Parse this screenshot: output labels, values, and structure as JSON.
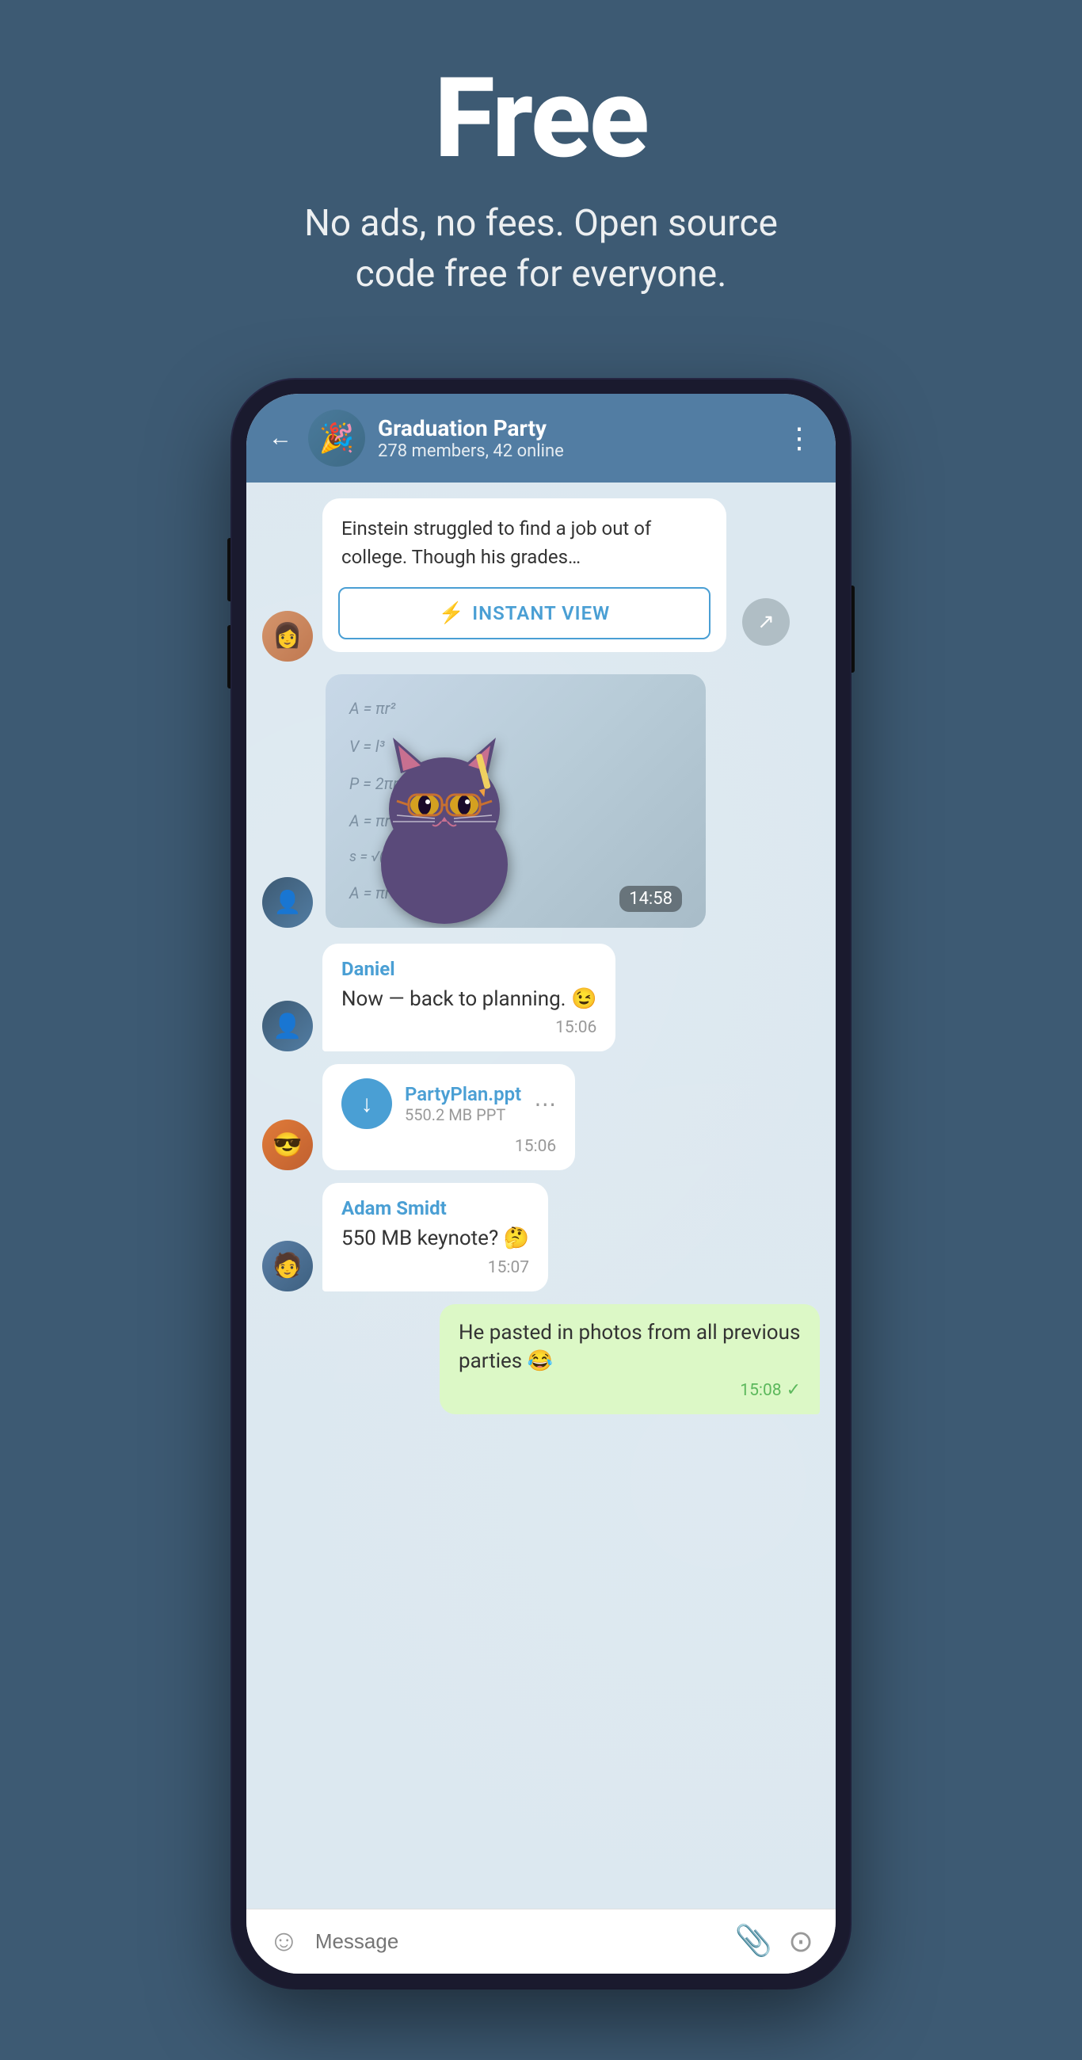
{
  "hero": {
    "title": "Free",
    "subtitle": "No ads, no fees. Open source code free for everyone."
  },
  "chat": {
    "header": {
      "back_label": "←",
      "group_name": "Graduation Party",
      "group_members": "278 members, 42 online",
      "menu_label": "⋮"
    },
    "article": {
      "text": "Einstein struggled to find a job out of college. Though his grades…",
      "instant_view_label": "INSTANT VIEW"
    },
    "sticker": {
      "time": "14:58"
    },
    "messages": [
      {
        "sender": "Daniel",
        "text": "Now — back to planning. 😉",
        "time": "15:06",
        "type": "received"
      },
      {
        "file_name": "PartyPlan.ppt",
        "file_size": "550.2 MB PPT",
        "time": "15:06",
        "type": "file"
      },
      {
        "sender": "Adam Smidt",
        "text": "550 MB keynote? 🤔",
        "time": "15:07",
        "type": "received"
      },
      {
        "text": "He pasted in photos from all previous parties 😂",
        "time": "15:08",
        "type": "sent"
      }
    ],
    "input": {
      "placeholder": "Message"
    }
  }
}
